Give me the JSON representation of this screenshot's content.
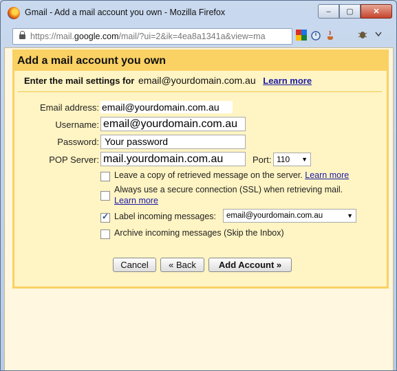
{
  "window": {
    "title": "Gmail - Add a mail account you own - Mozilla Firefox",
    "controls": {
      "minimize": "–",
      "maximize": "▢",
      "close": "✕"
    }
  },
  "addressbar": {
    "url_prefix": "https://mail.",
    "url_domain": "google.com",
    "url_rest": "/mail/?ui=2&ik=4ea8a1341a&view=ma"
  },
  "dialog": {
    "heading": "Add a mail account you own",
    "subtitle_prefix": "Enter the mail settings for",
    "subtitle_email": "email@yourdomain.com.au",
    "learn_more": "Learn more",
    "fields": {
      "email_label": "Email address:",
      "email_value": "email@yourdomain.com.au",
      "username_label": "Username:",
      "username_value": "email@yourdomain.com.au",
      "password_label": "Password:",
      "password_value": "Your password",
      "pop_label": "POP Server:",
      "pop_value": "mail.yourdomain.com.au",
      "port_label": "Port:",
      "port_value": "110"
    },
    "options": {
      "leave_copy": "Leave a copy of retrieved message on the server.",
      "leave_copy_link": "Learn more",
      "leave_copy_checked": false,
      "ssl": "Always use a secure connection (SSL) when retrieving mail.",
      "ssl_link": "Learn more",
      "ssl_checked": false,
      "label_incoming": "Label incoming messages:",
      "label_incoming_checked": true,
      "label_value": "email@yourdomain.com.au",
      "archive": "Archive incoming messages (Skip the Inbox)",
      "archive_checked": false
    },
    "buttons": {
      "cancel": "Cancel",
      "back": "« Back",
      "add": "Add Account »"
    }
  }
}
